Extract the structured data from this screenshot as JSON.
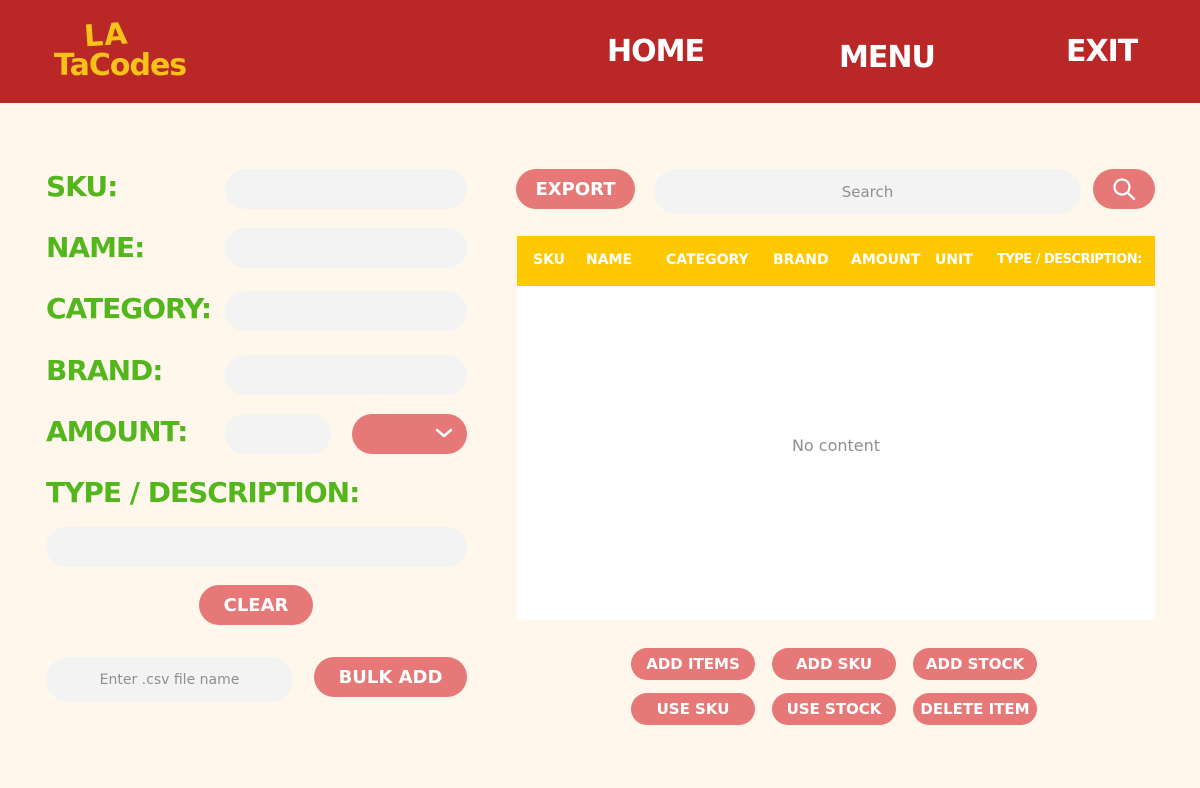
{
  "brand": {
    "logo_line1": "LA",
    "logo_line2": "TaCodes"
  },
  "nav": {
    "home": "HOME",
    "menu": "MENU",
    "exit": "EXIT"
  },
  "form": {
    "sku_label": "SKU:",
    "name_label": "NAME:",
    "category_label": "CATEGORY:",
    "brand_label": "BRAND:",
    "amount_label": "AMOUNT:",
    "type_label": "TYPE / DESCRIPTION:",
    "clear_label": "CLEAR",
    "csv_placeholder": "Enter .csv file name",
    "bulk_add_label": "BULK ADD"
  },
  "toolbar": {
    "export_label": "EXPORT",
    "search_placeholder": "Search"
  },
  "table": {
    "columns": [
      "SKU",
      "NAME",
      "CATEGORY",
      "BRAND",
      "AMOUNT",
      "UNIT",
      "TYPE / DESCRIPTION:"
    ],
    "empty_text": "No content"
  },
  "actions": {
    "add_items": "ADD ITEMS",
    "add_sku": "ADD SKU",
    "add_stock": "ADD STOCK",
    "use_sku": "USE SKU",
    "use_stock": "USE STOCK",
    "delete_item": "DELETE ITEM"
  },
  "colors": {
    "header_bg": "#b92727",
    "logo": "#f7c21a",
    "label_green": "#53b61d",
    "button_pink": "#e67878",
    "table_header": "#fdc801",
    "page_bg": "#fff7ec",
    "field_bg": "#f3f3f3"
  },
  "icons": {
    "search_button": "search-icon",
    "dropdown": "chevron-down-icon"
  }
}
